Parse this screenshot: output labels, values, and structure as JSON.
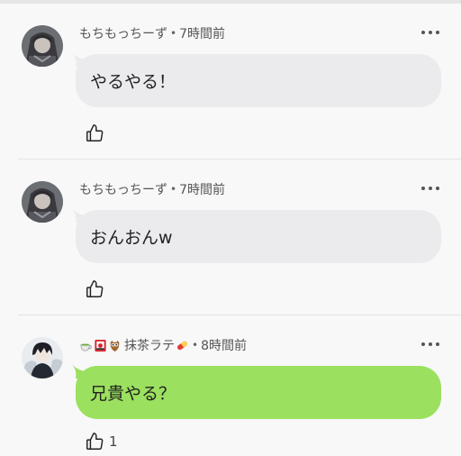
{
  "comments": [
    {
      "author": "もちもっちーず",
      "time": "7時間前",
      "text": "やるやる！",
      "like_count": "",
      "bubble_color": "#ebebed"
    },
    {
      "author": "もちもっちーず",
      "time": "7時間前",
      "text": "おんおんw",
      "like_count": "",
      "bubble_color": "#ebebed"
    },
    {
      "author": "抹茶ラテ",
      "author_badges": [
        "tea-icon",
        "flower-card-icon",
        "owl-icon"
      ],
      "author_suffix_icon": "pill-icon",
      "time": "8時間前",
      "text": "兄貴やる？",
      "like_count": "1",
      "bubble_color": "#9be05f"
    }
  ],
  "separator": "•"
}
